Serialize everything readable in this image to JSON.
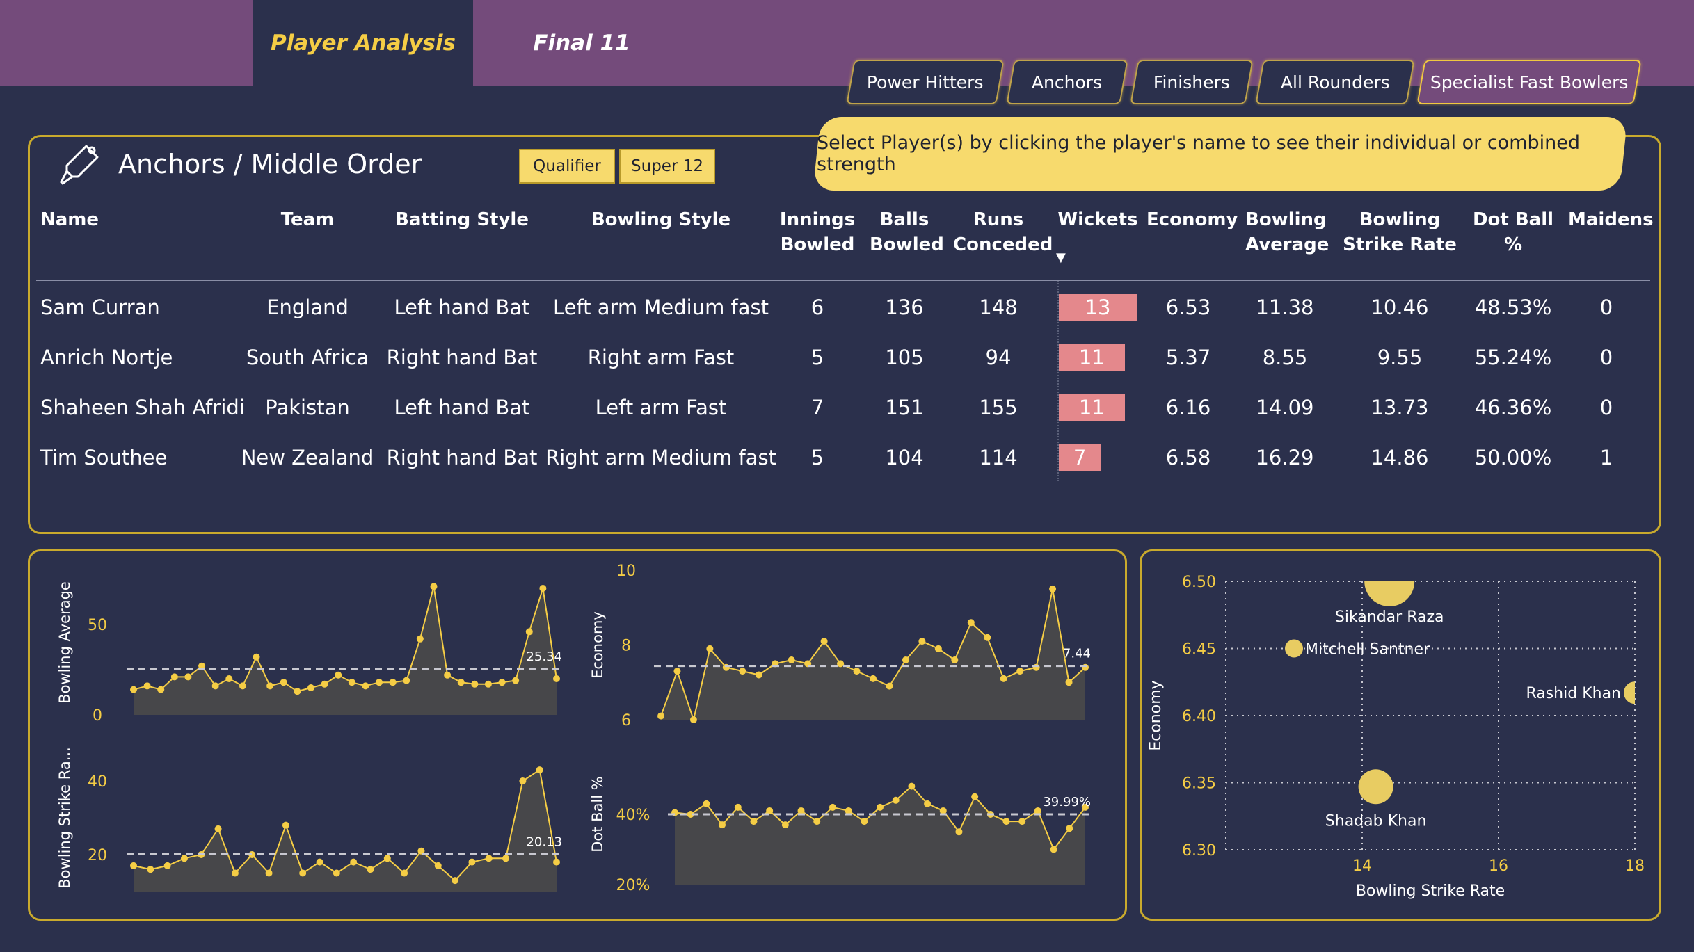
{
  "nav": {
    "tabs": [
      {
        "label": "Player Analysis"
      },
      {
        "label": "Final 11"
      }
    ]
  },
  "filters": [
    {
      "label": "Power Hitters"
    },
    {
      "label": "Anchors"
    },
    {
      "label": "Finishers"
    },
    {
      "label": "All Rounders"
    },
    {
      "label": "Specialist Fast Bowlers"
    }
  ],
  "section": {
    "title": "Anchors / Middle Order",
    "banner": "Select Player(s) by clicking the player's name to see their individual or combined strength",
    "slicers": [
      {
        "label": "Qualifier"
      },
      {
        "label": "Super 12"
      }
    ]
  },
  "table": {
    "headers": {
      "name": "Name",
      "team": "Team",
      "batting": "Batting Style",
      "bowling": "Bowling Style",
      "innings_1": "Innings",
      "innings_2": "Bowled",
      "balls_1": "Balls",
      "balls_2": "Bowled",
      "runs_1": "Runs",
      "runs_2": "Conceded",
      "wickets": "Wickets",
      "economy": "Economy",
      "avg_1": "Bowling",
      "avg_2": "Average",
      "sr_1": "Bowling",
      "sr_2": "Strike Rate",
      "dot": "Dot Ball %",
      "maidens": "Maidens"
    },
    "sort_indicator": "▼",
    "wickets_max": 13,
    "rows": [
      {
        "name": "Sam Curran",
        "team": "England",
        "batting": "Left hand Bat",
        "bowling": "Left arm Medium fast",
        "innings": "6",
        "balls": "136",
        "runs": "148",
        "wickets": "13",
        "economy": "6.53",
        "average": "11.38",
        "sr": "10.46",
        "dot": "48.53%",
        "maidens": "0"
      },
      {
        "name": "Anrich Nortje",
        "team": "South Africa",
        "batting": "Right hand Bat",
        "bowling": "Right arm Fast",
        "innings": "5",
        "balls": "105",
        "runs": "94",
        "wickets": "11",
        "economy": "5.37",
        "average": "8.55",
        "sr": "9.55",
        "dot": "55.24%",
        "maidens": "0"
      },
      {
        "name": "Shaheen Shah Afridi",
        "team": "Pakistan",
        "batting": "Left hand Bat",
        "bowling": "Left arm Fast",
        "innings": "7",
        "balls": "151",
        "runs": "155",
        "wickets": "11",
        "economy": "6.16",
        "average": "14.09",
        "sr": "13.73",
        "dot": "46.36%",
        "maidens": "0"
      },
      {
        "name": "Tim Southee",
        "team": "New Zealand",
        "batting": "Right hand Bat",
        "bowling": "Right arm Medium fast",
        "innings": "5",
        "balls": "104",
        "runs": "114",
        "wickets": "7",
        "economy": "6.58",
        "average": "16.29",
        "sr": "14.86",
        "dot": "50.00%",
        "maidens": "1"
      }
    ]
  },
  "chart_data": [
    {
      "type": "area",
      "ylabel": "Bowling Average",
      "ylim": [
        0,
        80
      ],
      "yticks": [
        "50",
        "0"
      ],
      "ytick_values": [
        50,
        0
      ],
      "avg_value": 25.34,
      "avg_label": "25.34",
      "values": [
        14,
        16,
        14,
        21,
        21,
        27,
        16,
        20,
        16,
        32,
        16,
        18,
        13,
        15,
        17,
        22,
        18,
        16,
        18,
        18,
        19,
        42,
        71,
        22,
        18,
        17,
        17,
        18,
        19,
        46,
        70,
        20
      ]
    },
    {
      "type": "area",
      "ylabel": "Economy",
      "ylim": [
        6,
        10
      ],
      "yticks": [
        "10",
        "8",
        "6"
      ],
      "ytick_values": [
        10,
        8,
        6
      ],
      "avg_value": 7.44,
      "avg_label": "7.44",
      "values": [
        6.1,
        7.3,
        6.0,
        7.9,
        7.4,
        7.3,
        7.2,
        7.5,
        7.6,
        7.5,
        8.1,
        7.5,
        7.3,
        7.1,
        6.9,
        7.6,
        8.1,
        7.9,
        7.6,
        8.6,
        8.2,
        7.1,
        7.3,
        7.4,
        9.5,
        7.0,
        7.4
      ]
    },
    {
      "type": "area",
      "ylabel": "Bowling Strike Ra...",
      "ylim": [
        10,
        50
      ],
      "yticks": [
        "40",
        "20"
      ],
      "ytick_values": [
        40,
        20
      ],
      "avg_value": 20.13,
      "avg_label": "20.13",
      "values": [
        17,
        16,
        17,
        19,
        20,
        27,
        15,
        20,
        15,
        28,
        15,
        18,
        15,
        18,
        16,
        19,
        15,
        21,
        17,
        13,
        18,
        19,
        19,
        40,
        43,
        18
      ]
    },
    {
      "type": "area",
      "ylabel": "Dot Ball %",
      "ylim": [
        20,
        60
      ],
      "yticks": [
        "40%",
        "20%"
      ],
      "ytick_values": [
        40,
        20
      ],
      "avg_value": 39.99,
      "avg_label": "39.99%",
      "values": [
        40.5,
        40,
        43,
        37,
        42,
        38,
        41,
        37,
        41,
        38,
        42,
        41,
        38,
        42,
        44,
        48,
        43,
        41,
        35,
        45,
        40,
        38,
        38,
        41,
        30,
        36,
        42
      ]
    },
    {
      "type": "scatter",
      "xlabel": "Bowling Strike Rate",
      "ylabel": "Economy",
      "xlim": [
        12,
        18
      ],
      "ylim": [
        6.3,
        6.5
      ],
      "xticks": [
        "14",
        "16",
        "18"
      ],
      "xtick_values": [
        14,
        16,
        18
      ],
      "yticks": [
        "6.50",
        "6.45",
        "6.40",
        "6.35",
        "6.30"
      ],
      "ytick_values": [
        6.5,
        6.45,
        6.4,
        6.35,
        6.3
      ],
      "points": [
        {
          "label": "Sikandar Raza",
          "x": 14.4,
          "y": 6.5,
          "size": 36
        },
        {
          "label": "Mitchell Santner",
          "x": 13.0,
          "y": 6.45,
          "size": 13
        },
        {
          "label": "Rashid Khan",
          "x": 18.0,
          "y": 6.417,
          "size": 16
        },
        {
          "label": "Shadab Khan",
          "x": 14.2,
          "y": 6.347,
          "size": 25
        }
      ]
    }
  ]
}
